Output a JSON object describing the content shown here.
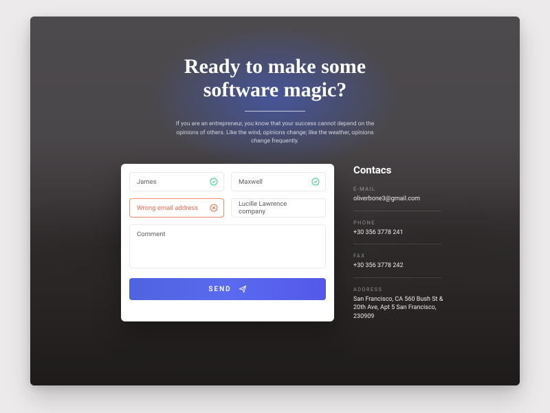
{
  "hero": {
    "title_l1": "Ready to make some",
    "title_l2": "software magic?",
    "subtitle": "If you are an entrepreneur, you know that your success cannot depend on the opinions of others. Like the wind, opinions change; like the weather, opinions change frequently."
  },
  "form": {
    "first_name": {
      "value": "James",
      "state": "valid"
    },
    "last_name": {
      "value": "Maxwell",
      "state": "valid"
    },
    "email": {
      "value": "Wrong email address",
      "state": "error"
    },
    "company": {
      "value": "Lucille Lawrence company",
      "state": "neutral"
    },
    "comment": {
      "placeholder": "Comment"
    },
    "submit_label": "SEND"
  },
  "contacts": {
    "heading": "Contacs",
    "email_label": "E-MAIL",
    "email": "oliverbone3@gmail.com",
    "phone_label": "PHONE",
    "phone": "+30 356 3778 241",
    "fax_label": "FAX",
    "fax": "+30 356 3778 242",
    "address_label": "ADDRESS",
    "address": "San Francisco, CA 560 Bush St & 20th Ave, Apt 5 San Francisco, 230909"
  }
}
